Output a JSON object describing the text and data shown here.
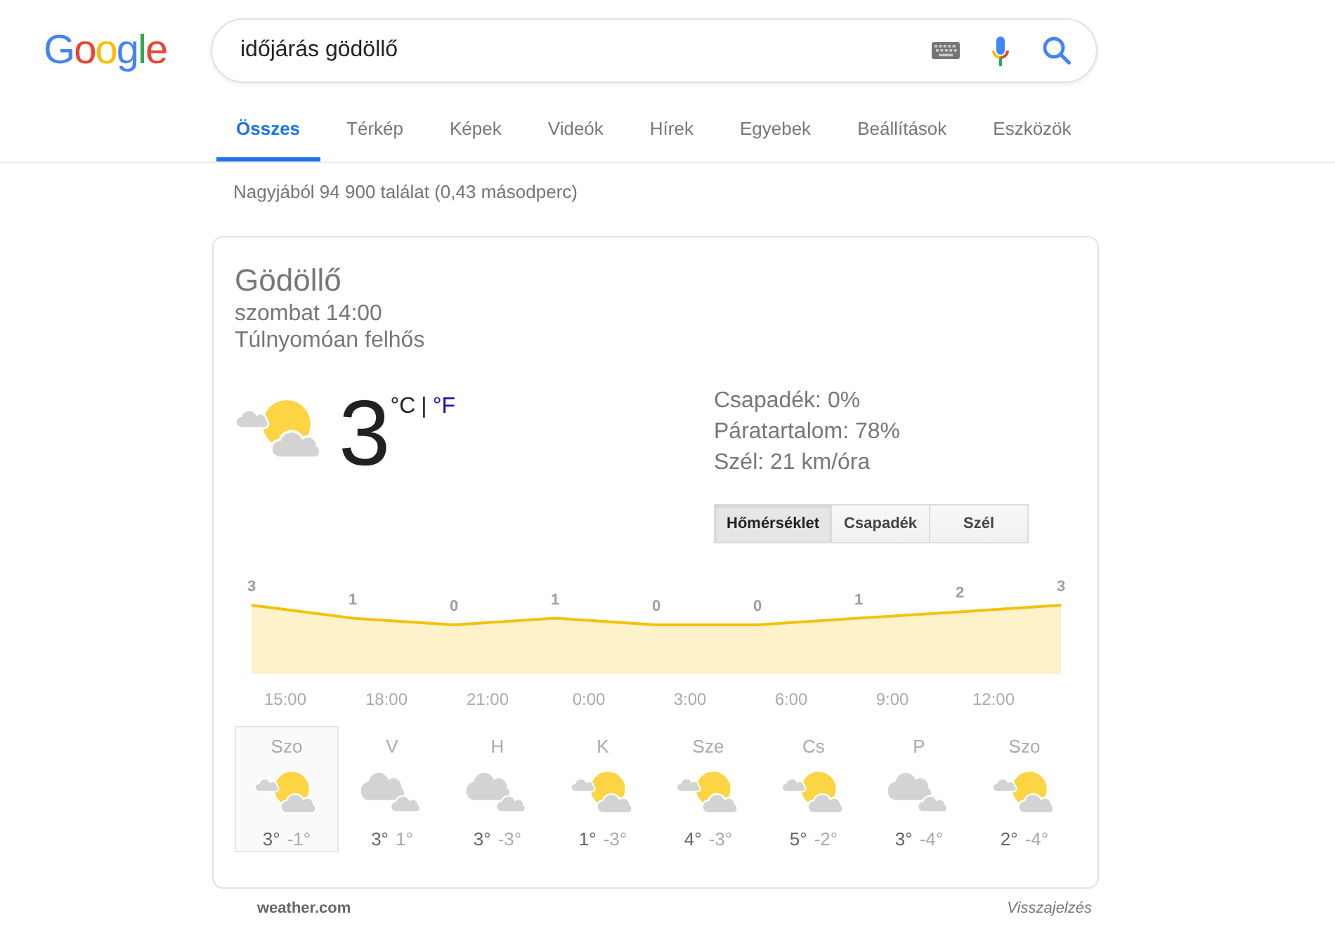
{
  "header": {
    "logo": "Google",
    "search": {
      "value": "időjárás gödöllő"
    }
  },
  "nav_tabs": [
    {
      "label": "Összes",
      "selected": true
    },
    {
      "label": "Térkép",
      "selected": false
    },
    {
      "label": "Képek",
      "selected": false
    },
    {
      "label": "Videók",
      "selected": false
    },
    {
      "label": "Hírek",
      "selected": false
    },
    {
      "label": "Egyebek",
      "selected": false
    },
    {
      "label": "Beállítások",
      "selected": false
    },
    {
      "label": "Eszközök",
      "selected": false
    }
  ],
  "result_stats": "Nagyjából 94 900 találat (0,43 másodperc)",
  "weather_card": {
    "location": "Gödöllő",
    "time": "szombat 14:00",
    "condition": "Túlnyomóan felhős",
    "current": {
      "kind": "partly_cloudy",
      "temperature": "3",
      "units": [
        {
          "label": "°C",
          "selected": true
        },
        {
          "label": "°F",
          "selected": false
        }
      ],
      "unit_separator": "|"
    },
    "details": [
      "Csapadék: 0%",
      "Páratartalom: 78%",
      "Szél: 21 km/óra"
    ],
    "chart_tabs": [
      {
        "label": "Hőmérséklet",
        "selected": true
      },
      {
        "label": "Csapadék",
        "selected": false
      },
      {
        "label": "Szél",
        "selected": false
      }
    ],
    "chart_data": {
      "type": "area",
      "categories": [
        null,
        null,
        null,
        null,
        null,
        null,
        null,
        null,
        null
      ],
      "series": [
        {
          "color": "#f4c20d",
          "values": [
            3,
            1,
            0,
            1,
            0,
            0,
            1,
            2,
            3
          ]
        }
      ],
      "data_labels": true,
      "annotations": [
        "15:00",
        "18:00",
        "21:00",
        "0:00",
        "3:00",
        "6:00",
        "9:00",
        "12:00"
      ]
    },
    "days": [
      {
        "day": "Szo",
        "kind": "partly_cloudy",
        "high": "3°",
        "low": "-1°",
        "selected": true
      },
      {
        "day": "V",
        "kind": "cloudy",
        "high": "3°",
        "low": "1°",
        "selected": false
      },
      {
        "day": "H",
        "kind": "cloudy",
        "high": "3°",
        "low": "-3°",
        "selected": false
      },
      {
        "day": "K",
        "kind": "partly_cloudy",
        "high": "1°",
        "low": "-3°",
        "selected": false
      },
      {
        "day": "Sze",
        "kind": "partly_cloudy",
        "high": "4°",
        "low": "-3°",
        "selected": false
      },
      {
        "day": "Cs",
        "kind": "partly_cloudy",
        "high": "5°",
        "low": "-2°",
        "selected": false
      },
      {
        "day": "P",
        "kind": "cloudy",
        "high": "3°",
        "low": "-4°",
        "selected": false
      },
      {
        "day": "Szo",
        "kind": "partly_cloudy",
        "high": "2°",
        "low": "-4°",
        "selected": false
      }
    ],
    "source": "weather.com",
    "feedback": "Visszajelzés"
  }
}
